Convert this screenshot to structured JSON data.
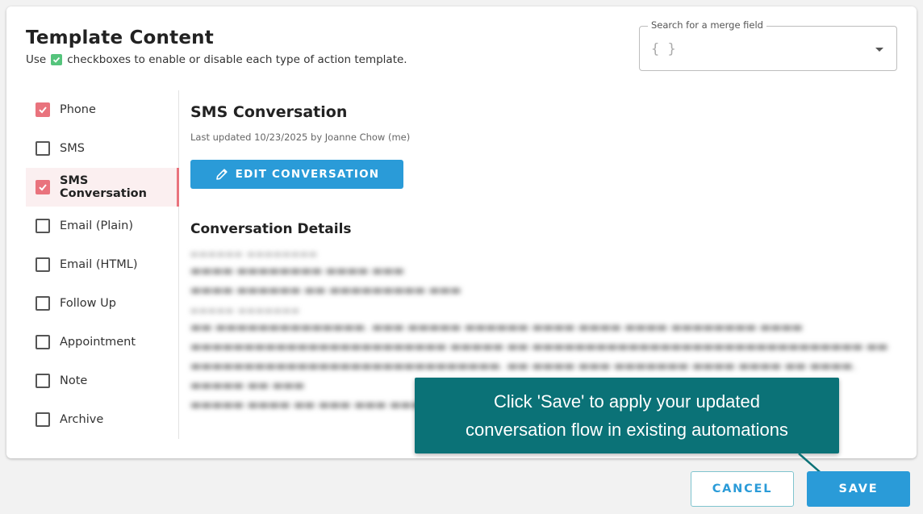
{
  "header": {
    "title": "Template Content",
    "subtitle_before": "Use",
    "subtitle_after": "checkboxes to enable or disable each type of action template."
  },
  "merge_field": {
    "label": "Search for a merge field",
    "value": "{ }"
  },
  "sidebar": {
    "items": [
      {
        "label": "Phone",
        "checked": true
      },
      {
        "label": "SMS",
        "checked": false
      },
      {
        "label": "SMS Conversation",
        "checked": true,
        "active": true
      },
      {
        "label": "Email (Plain)",
        "checked": false
      },
      {
        "label": "Email (HTML)",
        "checked": false
      },
      {
        "label": "Follow Up",
        "checked": false
      },
      {
        "label": "Appointment",
        "checked": false
      },
      {
        "label": "Note",
        "checked": false
      },
      {
        "label": "Archive",
        "checked": false
      }
    ]
  },
  "main": {
    "title": "SMS Conversation",
    "updated": "Last updated 10/23/2025 by Joanne Chow (me)",
    "edit_button": "EDIT CONVERSATION",
    "details_title": "Conversation Details"
  },
  "tooltip": {
    "line1": "Click 'Save' to apply your updated",
    "line2": "conversation flow in existing automations"
  },
  "footer": {
    "cancel": "CANCEL",
    "save": "SAVE"
  },
  "colors": {
    "accent_blue": "#2a9bd8",
    "checkbox_red": "#e9737d",
    "tooltip_teal": "#0b7277",
    "legend_green": "#55c47c"
  }
}
